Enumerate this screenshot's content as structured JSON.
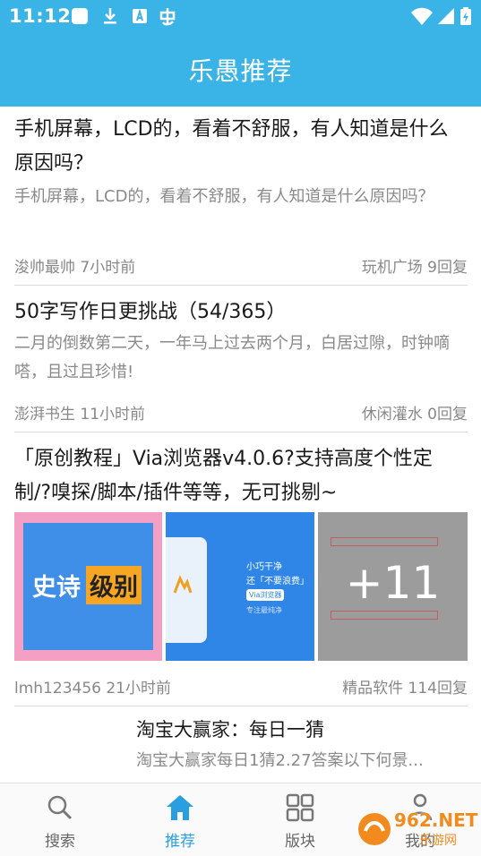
{
  "status_bar": {
    "time": "11:12"
  },
  "header": {
    "title": "乐愚推荐"
  },
  "posts": [
    {
      "title": "手机屏幕，LCD的，看着不舒服，有人知道是什么原因吗？",
      "summary": "手机屏幕，LCD的，看着不舒服，有人知道是什么原因吗？",
      "author_time": "浚帅最帅 7小时前",
      "forum_replies": "玩机广场 9回复"
    },
    {
      "title": "50字写作日更挑战（54/365）",
      "summary": "二月的倒数第二天，一年马上过去两个月，白居过隙，时钟嘀嗒，且过且珍惜!",
      "author_time": "澎湃书生 11小时前",
      "forum_replies": "休闲灌水 0回复"
    },
    {
      "title": "「原创教程」Via浏览器v4.0.6?支持高度个性定制/?嗅探/脚本/插件等等，无可挑剔~",
      "author_time": "lmh123456 21小时前",
      "forum_replies": "精品软件 114回复",
      "images": {
        "img1_text_a": "史诗",
        "img1_text_b": "级别",
        "img2_line1": "小巧干净",
        "img2_line2": "还「不要浪费」",
        "img2_badge": "Via浏览器",
        "img2_line3": "专注最纯净",
        "more_count": "+11"
      }
    }
  ],
  "preview": {
    "title": "淘宝大赢家：每日一猜",
    "summary": "淘宝大赢家每日1猜2.27答案以下何景..."
  },
  "bottom_nav": {
    "items": [
      {
        "label": "搜索",
        "icon": "search-icon"
      },
      {
        "label": "推荐",
        "icon": "home-icon",
        "active": true
      },
      {
        "label": "版块",
        "icon": "grid-icon"
      },
      {
        "label": "我的",
        "icon": "person-icon"
      }
    ]
  },
  "watermark": {
    "brand": "962.NET",
    "sub": "乐游网"
  },
  "colors": {
    "primary": "#3ab3e6",
    "active_nav": "#2a9fe0"
  }
}
